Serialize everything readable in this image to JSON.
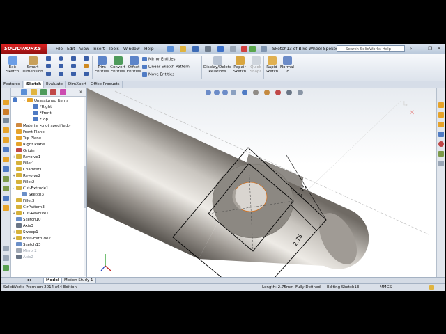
{
  "app": {
    "logo_text": "SOLIDWORKS",
    "menu": [
      "File",
      "Edit",
      "View",
      "Insert",
      "Tools",
      "Window",
      "Help"
    ],
    "document_title": "Sketch13 of Bike Wheel Spokes *",
    "help_placeholder": "Search SolidWorks Help"
  },
  "ribbon": {
    "exit_sketch": "Exit Sketch",
    "smart_dimension": "Smart Dimension",
    "trim_entities": "Trim Entities",
    "convert_entities": "Convert Entities",
    "offset_entities": "Offset Entities",
    "mirror_entities": "Mirror Entities",
    "linear_sketch_pattern": "Linear Sketch Pattern",
    "move_entities": "Move Entities",
    "display_delete_relations": "Display/Delete Relations",
    "repair_sketch": "Repair Sketch",
    "quick_snaps": "Quick Snaps",
    "rapid_sketch": "Rapid Sketch",
    "normal_to": "Normal To"
  },
  "command_tabs": [
    "Features",
    "Sketch",
    "Evaluate",
    "DimXpert",
    "Office Products"
  ],
  "active_command_tab": "Sketch",
  "feature_tree": [
    {
      "label": "Unassigned Items",
      "indent": 2,
      "icon": "folder-icon",
      "expander": "-"
    },
    {
      "label": "*Right",
      "indent": 3,
      "icon": "view-icon",
      "expander": ""
    },
    {
      "label": "*Front",
      "indent": 3,
      "icon": "view-icon",
      "expander": ""
    },
    {
      "label": "*Top",
      "indent": 3,
      "icon": "view-icon",
      "expander": ""
    },
    {
      "label": "Material <not specified>",
      "indent": 0,
      "icon": "material-icon",
      "expander": ""
    },
    {
      "label": "Front Plane",
      "indent": 0,
      "icon": "plane-icon",
      "expander": ""
    },
    {
      "label": "Top Plane",
      "indent": 0,
      "icon": "plane-icon",
      "expander": ""
    },
    {
      "label": "Right Plane",
      "indent": 0,
      "icon": "plane-icon",
      "expander": ""
    },
    {
      "label": "Origin",
      "indent": 0,
      "icon": "origin-icon",
      "expander": ""
    },
    {
      "label": "Revolve1",
      "indent": 0,
      "icon": "revolve-icon",
      "expander": "+"
    },
    {
      "label": "Fillet1",
      "indent": 0,
      "icon": "fillet-icon",
      "expander": ""
    },
    {
      "label": "Chamfer1",
      "indent": 0,
      "icon": "chamfer-icon",
      "expander": ""
    },
    {
      "label": "Revolve2",
      "indent": 0,
      "icon": "revolve-icon",
      "expander": "+"
    },
    {
      "label": "Fillet2",
      "indent": 0,
      "icon": "fillet-icon",
      "expander": ""
    },
    {
      "label": "Cut-Extrude1",
      "indent": 0,
      "icon": "cut-extrude-icon",
      "expander": "-"
    },
    {
      "label": "Sketch3",
      "indent": 1,
      "icon": "sketch-icon",
      "expander": ""
    },
    {
      "label": "Fillet3",
      "indent": 0,
      "icon": "fillet-icon",
      "expander": ""
    },
    {
      "label": "CirPattern3",
      "indent": 0,
      "icon": "pattern-icon",
      "expander": ""
    },
    {
      "label": "Cut-Revolve1",
      "indent": 0,
      "icon": "cut-revolve-icon",
      "expander": "+"
    },
    {
      "label": "Sketch10",
      "indent": 0,
      "icon": "sketch-icon",
      "expander": ""
    },
    {
      "label": "Axis3",
      "indent": 0,
      "icon": "axis-icon",
      "expander": ""
    },
    {
      "label": "Sweep1",
      "indent": 0,
      "icon": "sweep-icon",
      "expander": "+"
    },
    {
      "label": "Boss-Extrude2",
      "indent": 0,
      "icon": "boss-extrude-icon",
      "expander": "+"
    },
    {
      "label": "Sketch13",
      "indent": 0,
      "icon": "sketch-icon",
      "expander": ""
    },
    {
      "label": "Mirror2",
      "indent": 0,
      "icon": "mirror-icon",
      "expander": "",
      "dimmed": true
    },
    {
      "label": "Axis2",
      "indent": 0,
      "icon": "axis-icon",
      "expander": "",
      "dimmed": true
    }
  ],
  "viewport": {
    "dimension_1": "2.75",
    "dimension_2": "2.75"
  },
  "bottom_tabs": [
    "Model",
    "Motion Study 1"
  ],
  "active_bottom_tab": "Model",
  "status": {
    "edition": "SolidWorks Premium 2014 x64 Edition",
    "length": "Length: 2.75mm",
    "definition": "Fully Defined",
    "editing": "Editing Sketch13",
    "units": "MMGS"
  },
  "colors": {
    "logo_red": "#c41a1a",
    "sketch_line": "#000000",
    "construction_orange": "#d07020",
    "spoke_gray": "#8f8b86"
  }
}
